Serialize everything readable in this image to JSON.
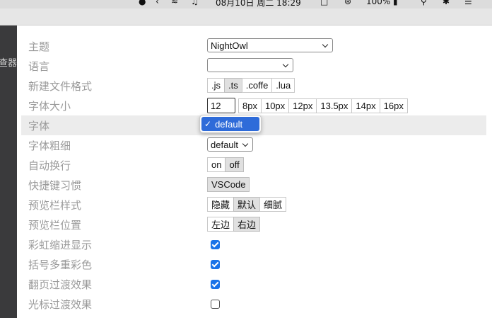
{
  "menubar": {
    "clock": "08月10日 周二 18:29",
    "battery": "100%"
  },
  "left_window": {
    "tail_text": "查器"
  },
  "colors": {
    "accent": "#1a73e8",
    "popup_highlight": "#2e6bd9"
  },
  "settings": {
    "theme": {
      "label": "主题",
      "value": "NightOwl"
    },
    "language": {
      "label": "语言",
      "value": ""
    },
    "new_file_format": {
      "label": "新建文件格式",
      "options": [
        ".js",
        ".ts",
        ".coffe",
        ".lua"
      ],
      "selected": ".ts"
    },
    "font_size": {
      "label": "字体大小",
      "value": "12",
      "options": [
        "8px",
        "10px",
        "12px",
        "13.5px",
        "14px",
        "16px"
      ]
    },
    "font": {
      "label": "字体",
      "popup_option": "default",
      "popup_check": "✓"
    },
    "font_weight": {
      "label": "字体粗细",
      "value": "default"
    },
    "word_wrap": {
      "label": "自动换行",
      "options": [
        "on",
        "off"
      ],
      "selected": "off"
    },
    "keybinding": {
      "label": "快捷键习惯",
      "options": [
        "VSCode"
      ],
      "selected": "VSCode"
    },
    "preview_style": {
      "label": "预览栏样式",
      "options": [
        "隐藏",
        "默认",
        "细腻"
      ],
      "selected": "默认"
    },
    "preview_position": {
      "label": "预览栏位置",
      "options": [
        "左边",
        "右边"
      ],
      "selected": "右边"
    },
    "rainbow_indent": {
      "label": "彩虹缩进显示",
      "checked": true
    },
    "bracket_colors": {
      "label": "括号多重彩色",
      "checked": true
    },
    "page_transition": {
      "label": "翻页过渡效果",
      "checked": true
    },
    "cursor_transition": {
      "label": "光标过渡效果",
      "checked": false
    }
  }
}
